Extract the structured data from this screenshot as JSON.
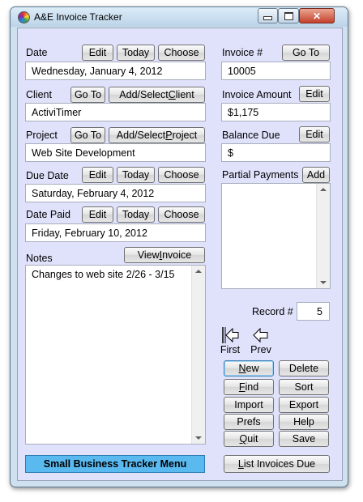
{
  "window": {
    "title": "A&E Invoice Tracker",
    "caption_buttons": {
      "minimize": "–",
      "maximize": "▭",
      "close": "✕"
    }
  },
  "date": {
    "label": "Date",
    "value": "Wednesday, January 4, 2012",
    "edit": "Edit",
    "today": "Today",
    "choose": "Choose"
  },
  "client": {
    "label": "Client",
    "value": "ActiviTimer",
    "goto": "Go To",
    "select_pre": "Add/Select ",
    "select_key": "C",
    "select_post": "lient"
  },
  "project": {
    "label": "Project",
    "value": "Web Site Development",
    "goto": "Go To",
    "select_pre": "Add/Select ",
    "select_key": "P",
    "select_post": "roject"
  },
  "due_date": {
    "label": "Due Date",
    "value": "Saturday, February 4, 2012",
    "edit": "Edit",
    "today": "Today",
    "choose": "Choose"
  },
  "date_paid": {
    "label": "Date Paid",
    "value": "Friday, February 10, 2012",
    "edit": "Edit",
    "today": "Today",
    "choose": "Choose"
  },
  "notes": {
    "label": "Notes",
    "value": "Changes to web site 2/26 - 3/15",
    "view_pre": "View ",
    "view_key": "I",
    "view_post": "nvoice"
  },
  "invoice": {
    "label": "Invoice #",
    "value": "10005",
    "goto": "Go To"
  },
  "amount": {
    "label": "Invoice Amount",
    "value": "$1,175",
    "edit": "Edit"
  },
  "balance": {
    "label": "Balance Due",
    "value": "$",
    "edit": "Edit"
  },
  "partial": {
    "label": "Partial Payments",
    "add": "Add"
  },
  "record": {
    "label": "Record #",
    "value": "5"
  },
  "nav": {
    "first": "First",
    "prev": "Prev"
  },
  "actions": {
    "new_key": "N",
    "new_rest": "ew",
    "delete": "Delete",
    "find_key": "F",
    "find_rest": "ind",
    "sort": "Sort",
    "import": "Import",
    "export": "Export",
    "prefs": "Prefs",
    "help": "Help",
    "quit_key": "Q",
    "quit_rest": "uit",
    "save": "Save"
  },
  "footer": {
    "menu": "Small Business Tracker Menu",
    "list_key": "L",
    "list_rest": "ist Invoices Due"
  },
  "colors": {
    "client_bg": "#e0e2fb",
    "menu_button": "#5ab9ef",
    "title_bar": "#cfe0ee"
  }
}
